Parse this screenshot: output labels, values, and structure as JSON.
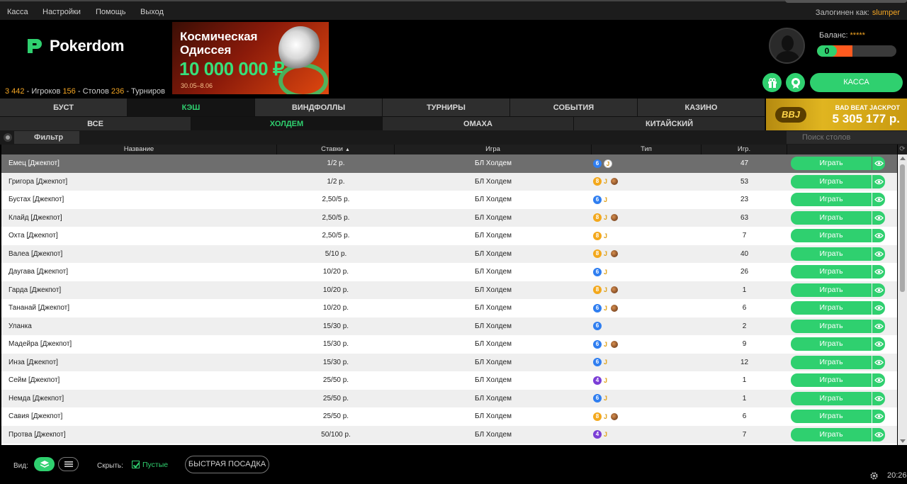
{
  "menu": {
    "items": [
      "Касса",
      "Настройки",
      "Помощь",
      "Выход"
    ],
    "logged_label": "Залогинен как:",
    "username": "slumper"
  },
  "header": {
    "brand": "Pokerdom",
    "stats": {
      "players_count": "3 442",
      "players_label": "- Игроков",
      "tables_count": "156",
      "tables_label": "- Столов",
      "tournaments_count": "236",
      "tournaments_label": "- Турниров"
    },
    "banner": {
      "title": "Космическая Одиссея",
      "amount": "10 000 000 ₽",
      "dates": "30.05–8.06"
    },
    "balance_label": "Баланс:",
    "balance_hidden": "*****",
    "balance_value": "0",
    "kassa_button": "КАССА"
  },
  "tabs": [
    "БУСТ",
    "КЭШ",
    "ВИНДФОЛЛЫ",
    "ТУРНИРЫ",
    "СОБЫТИЯ",
    "КАЗИНО"
  ],
  "active_tab": "КЭШ",
  "subtabs": [
    "ВСЕ",
    "ХОЛДЕМ",
    "ОМАХА",
    "КИТАЙСКИЙ"
  ],
  "active_subtab": "ХОЛДЕМ",
  "jackpot": {
    "badge": "BBJ",
    "label": "BAD BEAT JACKPOT",
    "value": "5 305 177 р."
  },
  "filter": {
    "label": "Фильтр",
    "search_placeholder": "Поиск столов"
  },
  "table": {
    "columns": [
      "Название",
      "Ставки",
      "Игра",
      "Тип",
      "Игр."
    ],
    "play_label": "Играть",
    "rows": [
      {
        "name": "Емец [Джекпот]",
        "stakes": "1/2 р.",
        "game": "БЛ Холдем",
        "badge": "6",
        "jackpot": true,
        "cup": false,
        "players": "47"
      },
      {
        "name": "Григора [Джекпот]",
        "stakes": "1/2 р.",
        "game": "БЛ Холдем",
        "badge": "8",
        "jackpot": true,
        "cup": true,
        "players": "53"
      },
      {
        "name": "Бустах [Джекпот]",
        "stakes": "2,50/5 р.",
        "game": "БЛ Холдем",
        "badge": "6",
        "jackpot": true,
        "cup": false,
        "players": "23"
      },
      {
        "name": "Клайд [Джекпот]",
        "stakes": "2,50/5 р.",
        "game": "БЛ Холдем",
        "badge": "8",
        "jackpot": true,
        "cup": true,
        "players": "63"
      },
      {
        "name": "Охта [Джекпот]",
        "stakes": "2,50/5 р.",
        "game": "БЛ Холдем",
        "badge": "8",
        "jackpot": true,
        "cup": false,
        "players": "7"
      },
      {
        "name": "Валеа [Джекпот]",
        "stakes": "5/10 р.",
        "game": "БЛ Холдем",
        "badge": "8",
        "jackpot": true,
        "cup": true,
        "players": "40"
      },
      {
        "name": "Даугава [Джекпот]",
        "stakes": "10/20 р.",
        "game": "БЛ Холдем",
        "badge": "6",
        "jackpot": true,
        "cup": false,
        "players": "26"
      },
      {
        "name": "Гарда [Джекпот]",
        "stakes": "10/20 р.",
        "game": "БЛ Холдем",
        "badge": "8",
        "jackpot": true,
        "cup": true,
        "players": "1"
      },
      {
        "name": "Тананай [Джекпот]",
        "stakes": "10/20 р.",
        "game": "БЛ Холдем",
        "badge": "6",
        "jackpot": true,
        "cup": true,
        "players": "6"
      },
      {
        "name": "Уланка",
        "stakes": "15/30 р.",
        "game": "БЛ Холдем",
        "badge": "6",
        "jackpot": false,
        "cup": false,
        "players": "2"
      },
      {
        "name": "Мадейра [Джекпот]",
        "stakes": "15/30 р.",
        "game": "БЛ Холдем",
        "badge": "6",
        "jackpot": true,
        "cup": true,
        "players": "9"
      },
      {
        "name": "Инза [Джекпот]",
        "stakes": "15/30 р.",
        "game": "БЛ Холдем",
        "badge": "6",
        "jackpot": true,
        "cup": false,
        "players": "12"
      },
      {
        "name": "Сейм [Джекпот]",
        "stakes": "25/50 р.",
        "game": "БЛ Холдем",
        "badge": "4",
        "jackpot": true,
        "cup": false,
        "players": "1"
      },
      {
        "name": "Немда [Джекпот]",
        "stakes": "25/50 р.",
        "game": "БЛ Холдем",
        "badge": "6",
        "jackpot": true,
        "cup": false,
        "players": "1"
      },
      {
        "name": "Савия [Джекпот]",
        "stakes": "25/50 р.",
        "game": "БЛ Холдем",
        "badge": "8",
        "jackpot": true,
        "cup": true,
        "players": "6"
      },
      {
        "name": "Протва [Джекпот]",
        "stakes": "50/100 р.",
        "game": "БЛ Холдем",
        "badge": "4",
        "jackpot": true,
        "cup": false,
        "players": "7"
      }
    ],
    "selected_row": 0
  },
  "bottom": {
    "view_label": "Вид:",
    "hide_label": "Скрыть:",
    "empty_label": "Пустые",
    "quick_seat": "БЫСТРАЯ ПОСАДКА",
    "time": "20:26"
  },
  "colors": {
    "accent": "#2fd06f",
    "orange": "#f5a623",
    "badge6": "#2f7ef0",
    "badge8": "#f3a81c",
    "badge4": "#7b3ed6"
  }
}
